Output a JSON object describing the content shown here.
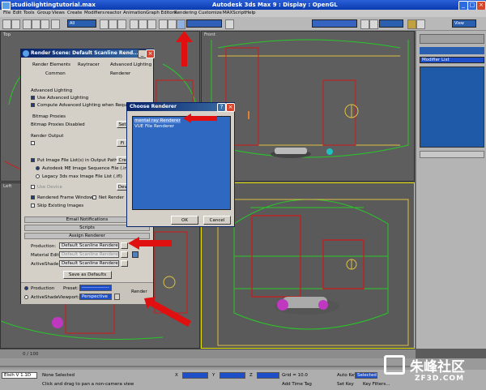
{
  "app": {
    "file_title": "studiolightingtutorial.max",
    "center_title": "Autodesk 3ds Max 9    :    Display : OpenGL"
  },
  "menubar": [
    "File",
    "Edit",
    "Tools",
    "Group",
    "Views",
    "Create",
    "Modifiers",
    "reactor",
    "Animation",
    "Graph Editors",
    "Rendering",
    "Customize",
    "MAXScript",
    "Help"
  ],
  "toolbar": {
    "selection_filter": "All",
    "view_dropdown": "View"
  },
  "viewports": {
    "top": "Top",
    "front": "Front",
    "left": "Left"
  },
  "command_panel": {
    "modifier_list": "Modifier List"
  },
  "render_dialog": {
    "title": "Render Scene: Default Scanline Rend...",
    "tabs_row1": [
      "Render Elements",
      "Raytracer",
      "Advanced Lighting"
    ],
    "tabs_row2": [
      "Common",
      "Renderer"
    ],
    "advanced_lighting": {
      "group": "Advanced Lighting",
      "use": "Use Advanced Lighting",
      "compute": "Compute Advanced Lighting when Required"
    },
    "bitmap_proxies": {
      "group": "Bitmap Proxies",
      "status": "Bitmap Proxies Disabled",
      "setup_btn": "Set"
    },
    "render_output": {
      "group": "Render Output",
      "files_btn": "Fi",
      "put_image": "Put Image File List(s) in Output Path(s)",
      "create_btn": "Creat",
      "autodesk_seq": "Autodesk ME Image Sequence File (.imsq)",
      "legacy": "Legacy 3ds max Image File List (.ifl)",
      "use_device": "Use Device",
      "devices_btn": "Devi",
      "rendered_frame": "Rendered Frame Window",
      "net_render": "Net Render",
      "skip_existing": "Skip Existing Images"
    },
    "email_notifications": "Email Notifications",
    "scripts": "Scripts",
    "assign_renderer": {
      "group": "Assign Renderer",
      "production_label": "Production:",
      "production_value": "Default Scanline Renderer",
      "material_label": "Material Editor:",
      "material_value": "Default Scanline Renderer",
      "activeshade_label": "ActiveShade:",
      "activeshade_value": "Default Scanline Renderer",
      "save_defaults": "Save as Defaults"
    },
    "bottom": {
      "production": "Production",
      "activeshade": "ActiveShade",
      "preset_label": "Preset:",
      "preset_value": "-----------------",
      "viewport_label": "Viewport:",
      "viewport_value": "Perspective",
      "render_btn": "Render"
    }
  },
  "choose_renderer": {
    "title": "Choose Renderer",
    "items": [
      "mental ray Renderer",
      "VUE File Renderer"
    ],
    "ok": "OK",
    "cancel": "Cancel"
  },
  "timeslider": {
    "frame": "0 / 100"
  },
  "status": {
    "maxscript": "Elsih V 1.1D",
    "none_selected": "None Selected",
    "prompt": "Click and drag to pan a non-camera view",
    "x_label": "X",
    "y_label": "Y",
    "z_label": "Z",
    "grid": "Grid = 10.0",
    "add_time_tag": "Add Time Tag",
    "auto_key": "Auto Key",
    "selected": "Selected",
    "set_key": "Set Key",
    "key_filters": "Key Filters..."
  },
  "watermark": {
    "cn": "朱峰社区",
    "url": "ZF3D.COM"
  },
  "colors": {
    "accent": "#e01010",
    "wire_red": "#d21818",
    "wire_green": "#28c828",
    "highlight_blue": "#1e4ec8"
  }
}
